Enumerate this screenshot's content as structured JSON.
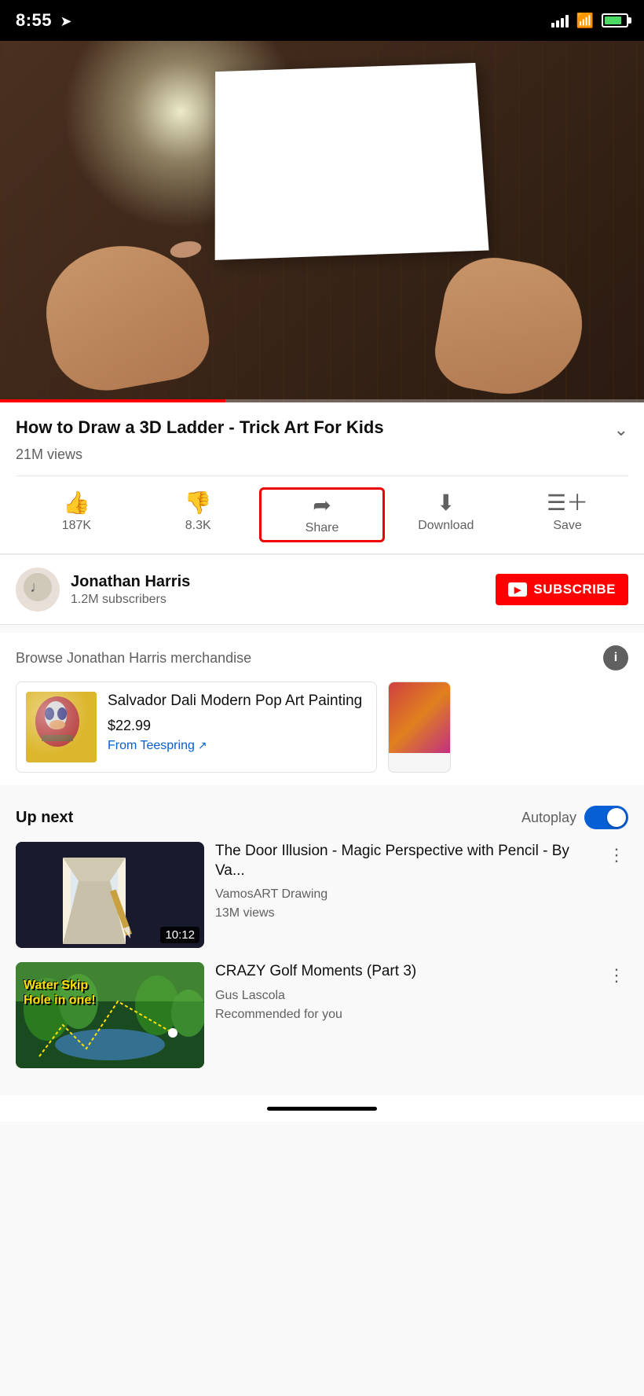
{
  "status": {
    "time": "8:55",
    "location_active": true
  },
  "video": {
    "title": "How to Draw a 3D Ladder - Trick Art For Kids",
    "views": "21M views",
    "likes": "187K",
    "dislikes": "8.3K",
    "actions": {
      "like_label": "187K",
      "dislike_label": "8.3K",
      "share_label": "Share",
      "download_label": "Download",
      "save_label": "Save"
    }
  },
  "channel": {
    "name": "Jonathan Harris",
    "subscribers": "1.2M subscribers",
    "subscribe_label": "SUBSCRIBE"
  },
  "merch": {
    "section_title": "Browse Jonathan Harris merchandise",
    "item1": {
      "name": "Salvador Dali Modern Pop Art Painting",
      "price": "$22.99",
      "source": "From Teespring"
    }
  },
  "upnext": {
    "label": "Up next",
    "autoplay_label": "Autoplay",
    "video1": {
      "title": "The Door Illusion - Magic Perspective with Pencil - By Va...",
      "channel": "VamosART Drawing",
      "views": "13M views",
      "duration": "10:12"
    },
    "video2": {
      "title": "CRAZY Golf Moments (Part 3)",
      "channel": "Gus Lascola",
      "views": "",
      "recommended": "Recommended for you"
    }
  }
}
